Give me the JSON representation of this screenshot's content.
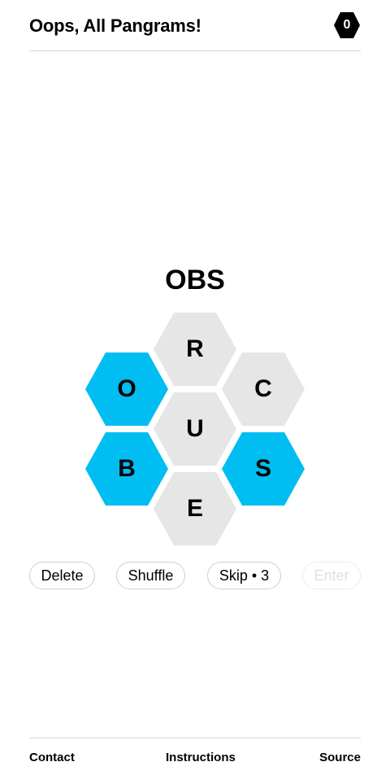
{
  "app": {
    "title": "Oops, All Pangrams!",
    "score": "0"
  },
  "puzzle": {
    "current_word": "OBS",
    "highlight_color": "#00bdf2",
    "idle_color": "#e6e6e6",
    "letters": {
      "top": "R",
      "upper_left": "O",
      "upper_right": "C",
      "center": "U",
      "lower_left": "B",
      "lower_right": "S",
      "bottom": "E"
    },
    "selected": [
      "O",
      "B",
      "S"
    ]
  },
  "controls": {
    "delete_label": "Delete",
    "shuffle_label": "Shuffle",
    "skip_label": "Skip • 3",
    "enter_label": "Enter"
  },
  "footer": {
    "contact_label": "Contact",
    "instructions_label": "Instructions",
    "source_label": "Source"
  }
}
